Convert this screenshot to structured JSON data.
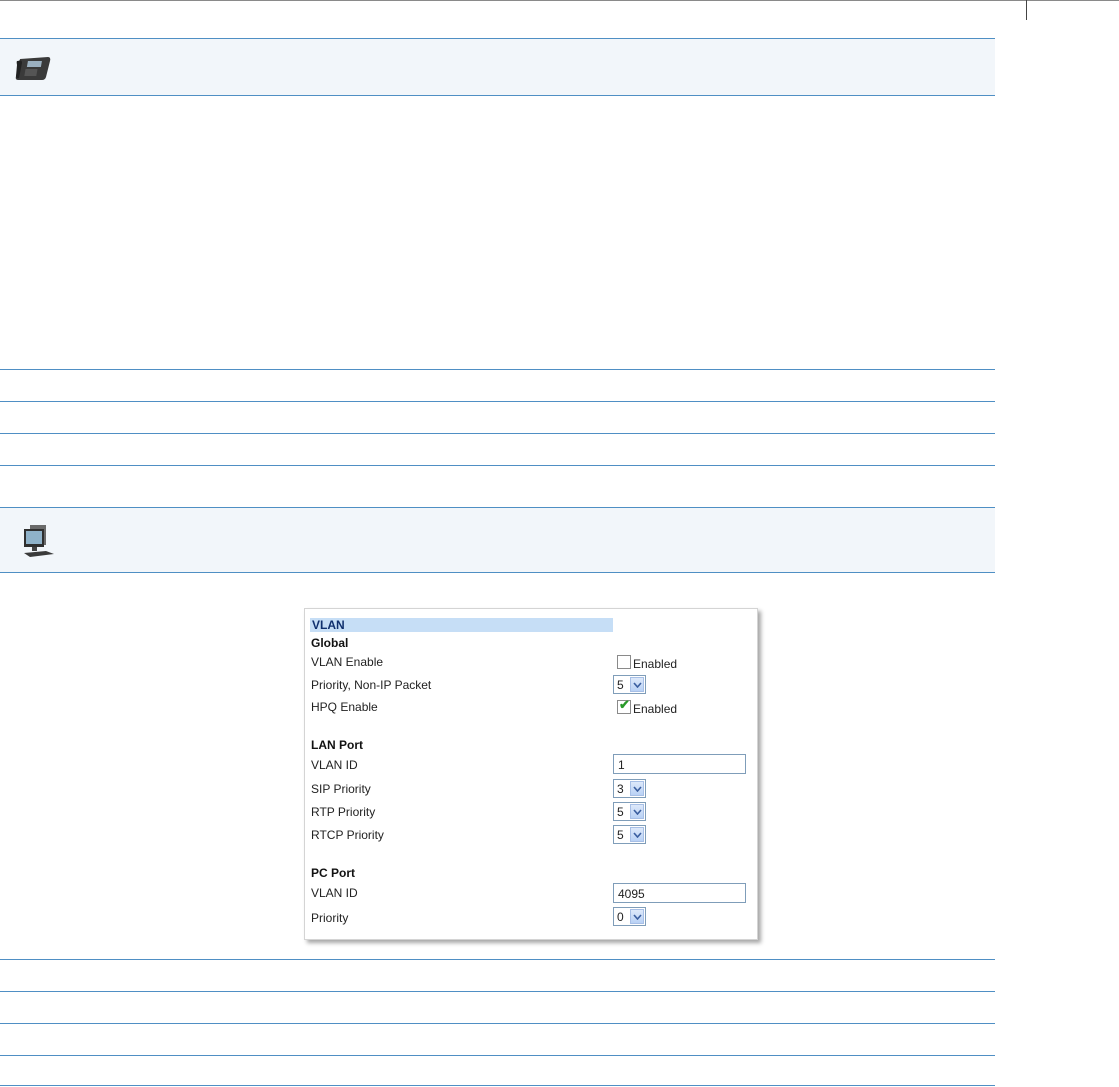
{
  "panel": {
    "title": "VLAN",
    "global": {
      "heading": "Global",
      "vlan_enable": {
        "label": "VLAN Enable",
        "checked": false,
        "option": "Enabled"
      },
      "priority_non_ip": {
        "label": "Priority, Non-IP Packet",
        "value": "5"
      },
      "hpq_enable": {
        "label": "HPQ Enable",
        "checked": true,
        "option": "Enabled"
      }
    },
    "lan_port": {
      "heading": "LAN Port",
      "vlan_id": {
        "label": "VLAN ID",
        "value": "1"
      },
      "sip_priority": {
        "label": "SIP Priority",
        "value": "3"
      },
      "rtp_priority": {
        "label": "RTP Priority",
        "value": "5"
      },
      "rtcp_priority": {
        "label": "RTCP Priority",
        "value": "5"
      }
    },
    "pc_port": {
      "heading": "PC Port",
      "vlan_id": {
        "label": "VLAN ID",
        "value": "4095"
      },
      "priority": {
        "label": "Priority",
        "value": "0"
      }
    }
  },
  "icons": [
    "phone-icon",
    "computer-icon",
    "checkmark-icon",
    "chevron-down-icon"
  ],
  "colors": {
    "rule_blue": "#4f8fc4",
    "band_bg": "#f2f6fa",
    "title_bg": "#c6def6",
    "check_green": "#2a9a2a"
  }
}
